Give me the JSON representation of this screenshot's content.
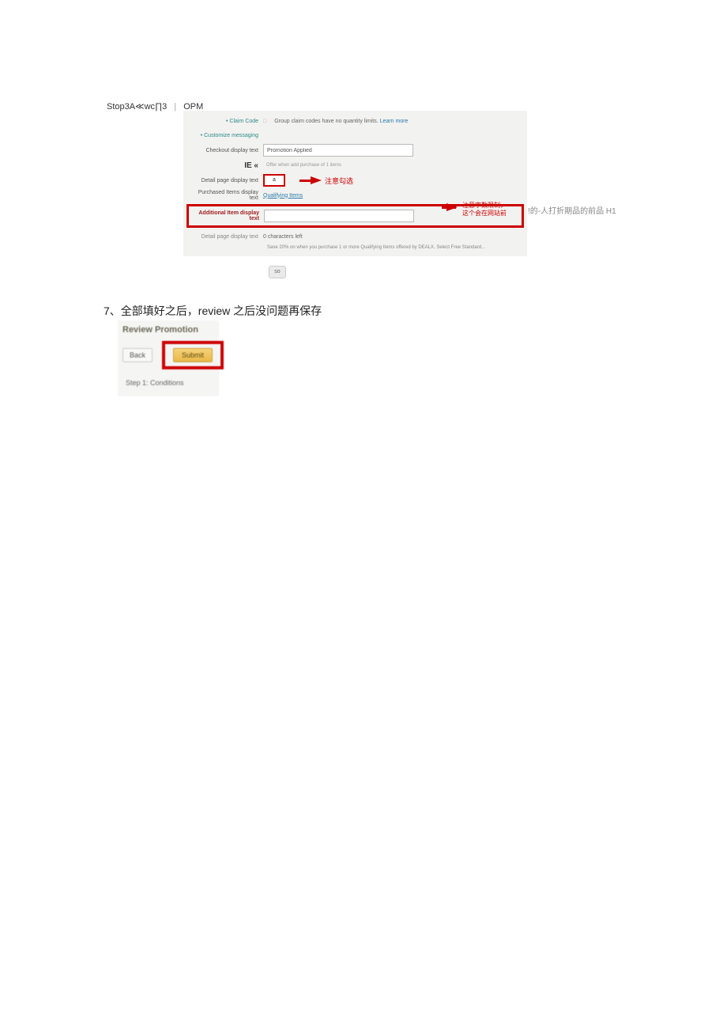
{
  "header": {
    "left": "Stop3A≪wc∏3",
    "right": "OPM"
  },
  "form": {
    "claim_code_label": "• Claim Code",
    "claim_code_hint": "Group claim codes have no quantity limits.",
    "learn_more": "Learn more",
    "customize_messaging_label": "• Customize messaging",
    "checkout_display_label": "Checkout display text",
    "checkout_display_value": "Promotion Applied",
    "ie_label": "IE «",
    "ie_sub": "Offer when add purchase of 1 items",
    "detail_page_label": "Detail page display text",
    "detail_select": "a",
    "detail_anno": "注意勾选",
    "purchased_items_label": "Purchased Items display text",
    "purchased_items_value": "Qualifying Items",
    "additional_items_label": "Additional Item display text",
    "detail_page_display_label": "Detail page display text",
    "detail_page_display_value": "0 characters left",
    "footnote": "Save 20% on when you purchase 1 or more Qualifying Items offered by DEALX. Select Free Standard..."
  },
  "right_anno": {
    "line1": "注意字数限制，",
    "line2": "这个会在网站前"
  },
  "far_right": "!的-人打折期品的前品 H1",
  "pill": "so",
  "step7": "7、全部填好之后，review 之后没问题再保存",
  "review": {
    "title": "Review Promotion",
    "back": "Back",
    "submit": "Submit",
    "step1": "Step 1: Conditions"
  }
}
